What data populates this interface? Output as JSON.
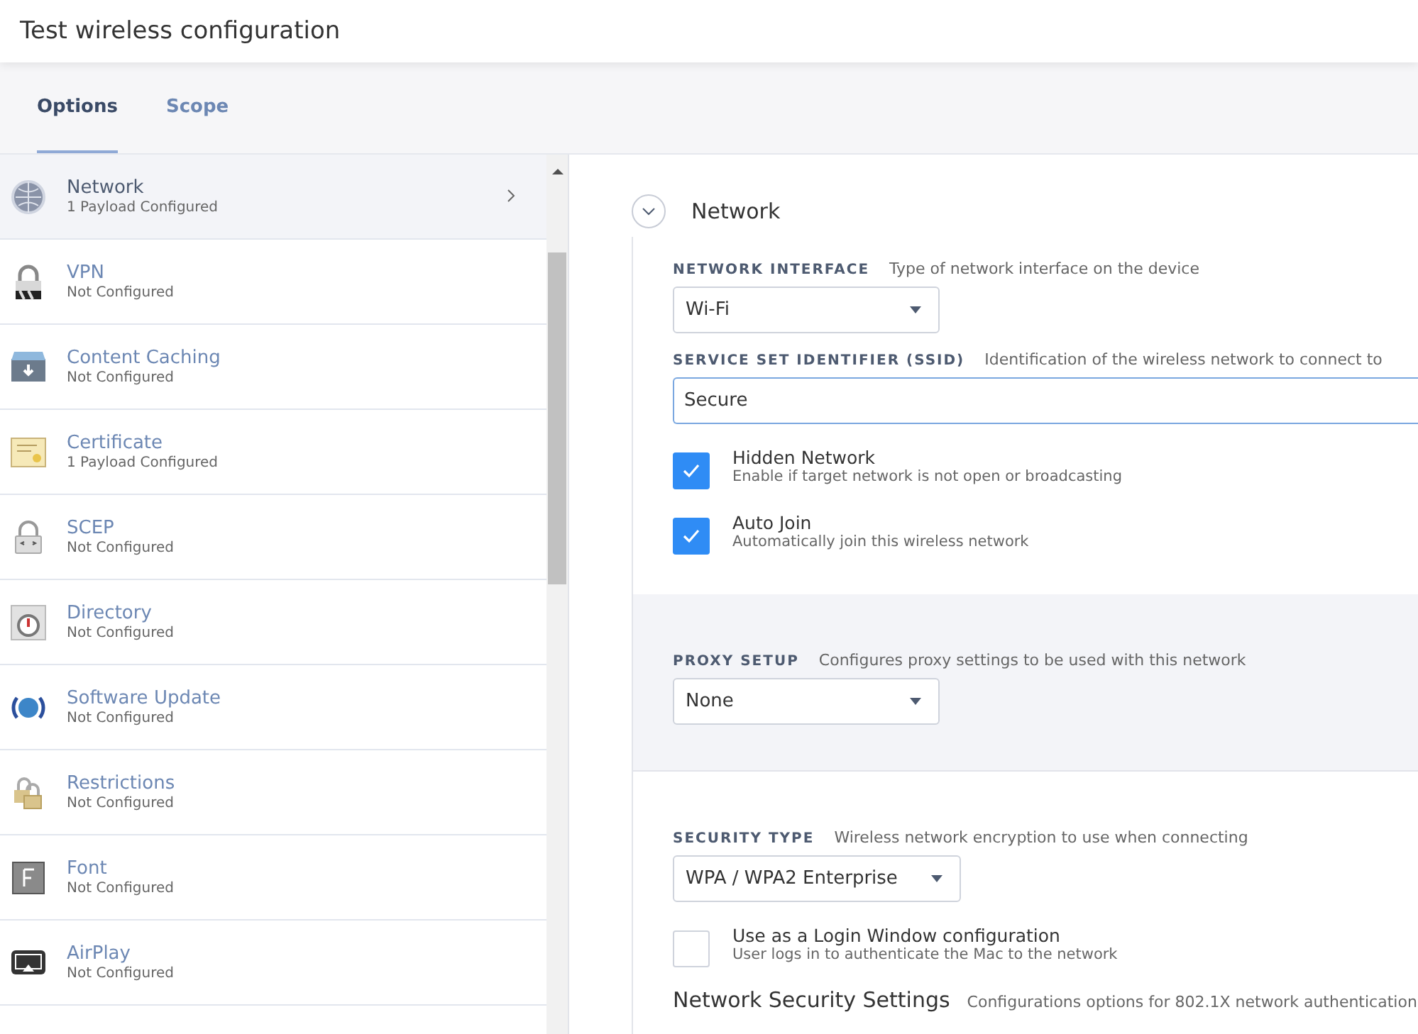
{
  "window": {
    "title": "Test wireless configuration"
  },
  "tabs": [
    {
      "label": "Options",
      "selected": true
    },
    {
      "label": "Scope",
      "selected": false
    }
  ],
  "sidebar": {
    "items": [
      {
        "name": "Network",
        "status": "1 Payload Configured",
        "selected": true
      },
      {
        "name": "VPN",
        "status": "Not Configured",
        "selected": false
      },
      {
        "name": "Content Caching",
        "status": "Not Configured",
        "selected": false
      },
      {
        "name": "Certificate",
        "status": "1 Payload Configured",
        "selected": false
      },
      {
        "name": "SCEP",
        "status": "Not Configured",
        "selected": false
      },
      {
        "name": "Directory",
        "status": "Not Configured",
        "selected": false
      },
      {
        "name": "Software Update",
        "status": "Not Configured",
        "selected": false
      },
      {
        "name": "Restrictions",
        "status": "Not Configured",
        "selected": false
      },
      {
        "name": "Font",
        "status": "Not Configured",
        "selected": false
      },
      {
        "name": "AirPlay",
        "status": "Not Configured",
        "selected": false
      }
    ]
  },
  "section": {
    "title": "Network",
    "expanded": true,
    "groups": [
      {
        "shaded": false,
        "fields": [
          {
            "kind": "select",
            "label": "NETWORK INTERFACE",
            "hint": "Type of network interface on the device",
            "value": "Wi-Fi"
          },
          {
            "kind": "text",
            "label": "SERVICE SET IDENTIFIER (SSID)",
            "hint": "Identification of the wireless network to connect to",
            "value": "Secure"
          },
          {
            "kind": "checkbox",
            "label": "Hidden Network",
            "hint": "Enable if target network is not open or broadcasting",
            "checked": true
          },
          {
            "kind": "checkbox",
            "label": "Auto Join",
            "hint": "Automatically join this wireless network",
            "checked": true
          }
        ]
      },
      {
        "shaded": true,
        "fields": [
          {
            "kind": "select",
            "label": "PROXY SETUP",
            "hint": "Configures proxy settings to be used with this network",
            "value": "None"
          }
        ]
      },
      {
        "shaded": false,
        "fields": [
          {
            "kind": "select",
            "label": "SECURITY TYPE",
            "hint": "Wireless network encryption to use when connecting",
            "value": "WPA / WPA2 Enterprise"
          },
          {
            "kind": "checkbox",
            "label": "Use as a Login Window configuration",
            "hint": "User logs in to authenticate the Mac to the network",
            "checked": false
          },
          {
            "kind": "heading",
            "label": "Network Security Settings",
            "hint": "Configurations options for 802.1X network authentication"
          }
        ]
      }
    ]
  }
}
